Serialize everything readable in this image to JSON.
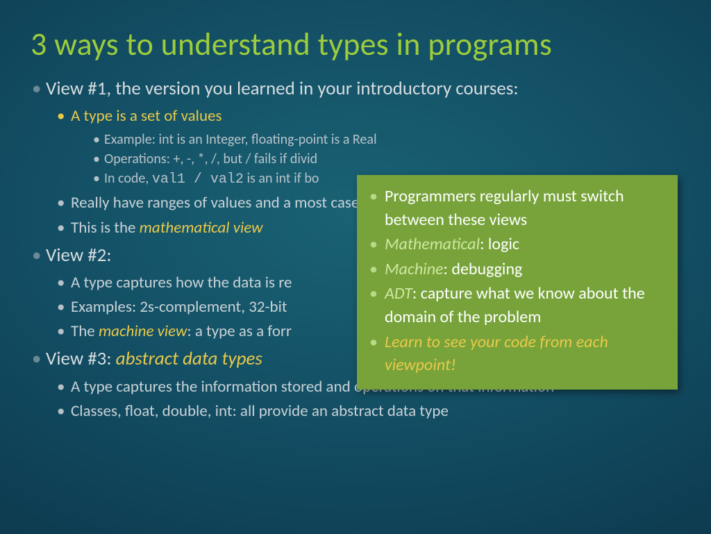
{
  "title": "3 ways to understand types in programs",
  "view1": {
    "head": "View #1, the version you learned in your introductory courses:",
    "sub1": "A type is a set of values",
    "ex1": "Example: int is an Integer, floating-point is a Real",
    "ex2": "Operations: +, -, *, /, but / fails if divid",
    "ex3a": "In code, ",
    "ex3b": "val1 / val2",
    "ex3c": " is an int if bo",
    "sub2": "Really have ranges of values and a most cases",
    "sub3a": "This is the ",
    "sub3b": "mathematical view"
  },
  "view2": {
    "head": "View #2:",
    "s1": "A type captures how the data is re",
    "s2": "Examples: 2s-complement, 32-bit",
    "s3a": "The ",
    "s3b": "machine view",
    "s3c": ": a type as a forr"
  },
  "view3": {
    "head_a": "View #3: ",
    "head_b": "abstract data types",
    "s1": "A type captures the information stored and operations on that information",
    "s2": "Classes, float, double, int: all provide an abstract data type"
  },
  "callout": {
    "l1": "Programmers regularly must switch between these views",
    "l2a": "Mathematical",
    "l2b": ": logic",
    "l3a": "Machine",
    "l3b": ": debugging",
    "l4a": "ADT",
    "l4b": ": capture what we know about the domain of the problem",
    "l5": "Learn to see your code from each viewpoint!"
  }
}
